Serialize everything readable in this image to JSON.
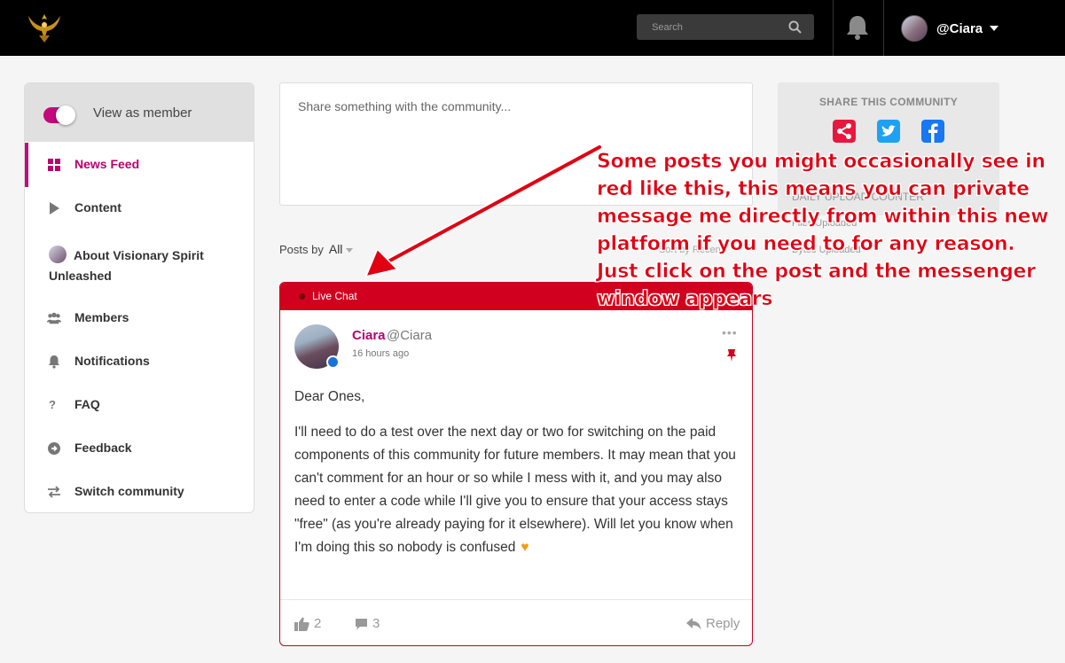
{
  "topbar": {
    "search_placeholder": "Search",
    "username": "@Ciara"
  },
  "sidebar": {
    "view_as_member": "View as member",
    "items": [
      {
        "label": "News Feed",
        "icon": "grid-icon",
        "active": true
      },
      {
        "label": "Content",
        "icon": "play-icon"
      },
      {
        "label": "About Visionary Spirit Unleashed",
        "icon": "avatar-icon"
      },
      {
        "label": "Members",
        "icon": "people-icon"
      },
      {
        "label": "Notifications",
        "icon": "bell-icon"
      },
      {
        "label": "FAQ",
        "icon": "question-icon"
      },
      {
        "label": "Feedback",
        "icon": "arrow-circle-icon"
      },
      {
        "label": "Switch community",
        "icon": "switch-icon"
      }
    ]
  },
  "composer": {
    "placeholder": "Share something with the community..."
  },
  "filter": {
    "label": "Posts by",
    "value": "All"
  },
  "post": {
    "tag": "Live Chat",
    "author": "Ciara",
    "handle": "@Ciara",
    "time": "16 hours ago",
    "greeting": "Dear Ones,",
    "text": "I'll need to do a test over the next day or two for switching on the paid components of this community for future members. It may mean that you can't comment for an hour or so while I mess with it, and you may also need to enter a code while I'll give you to ensure that your access stays \"free\" (as you're already paying for it elsewhere). Will let you know when I'm doing this so nobody is confused",
    "likes": "2",
    "comments": "3",
    "reply_label": "Reply"
  },
  "share": {
    "title": "SHARE THIS COMMUNITY",
    "ghost_1": "DAILY UPLOAD COUNTER",
    "ghost_2": "Files Uploaded",
    "ghost_3": "Sort by   Recent",
    "ghost_4": "Bytes Uploaded"
  },
  "annotation": {
    "text": "Some posts you might occasionally see in red like this, this means you can private message me directly from within this new platform if you need to for any reason. Just click on the post and the messenger window appears"
  },
  "colors": {
    "brand": "#c20a7a",
    "post_red": "#d2001f",
    "annotation_red": "#e00012",
    "share_red": "#e8173d",
    "twitter": "#1da1f2",
    "facebook": "#1877f2"
  }
}
